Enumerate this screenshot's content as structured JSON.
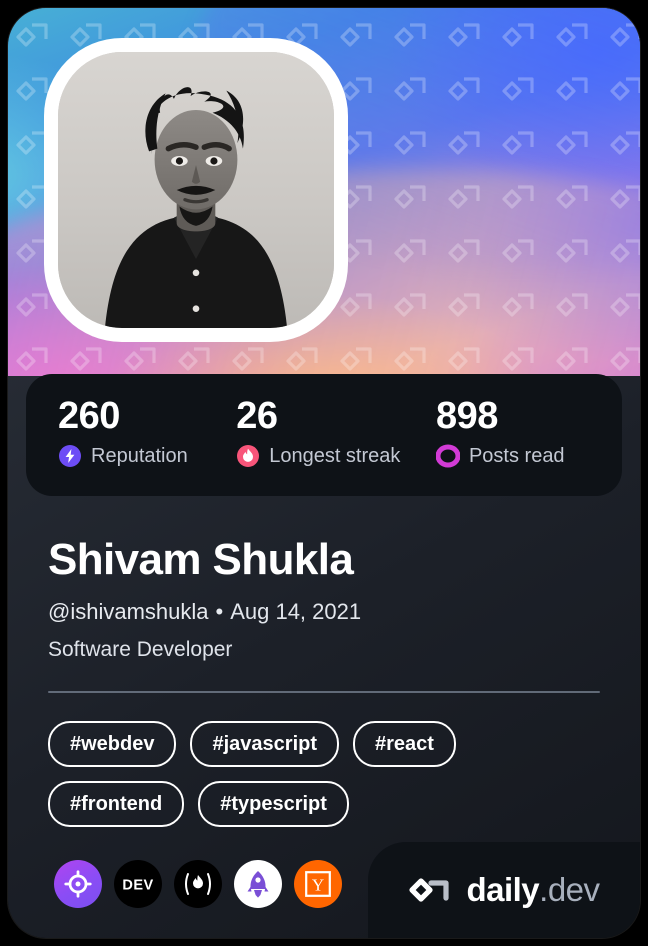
{
  "card": {
    "type": "devcard",
    "theme_accent": "#8a4df5",
    "card_bg": "#262b34",
    "stats_bar_bg": "#0e1217"
  },
  "avatar": {
    "icon": "user-photo",
    "alt": "Shivam Shukla profile photo",
    "border_color": "#ffffff"
  },
  "stats": [
    {
      "value": "260",
      "label": "Reputation",
      "icon": "bolt-icon",
      "color": "#6d4df6"
    },
    {
      "value": "26",
      "label": "Longest streak",
      "icon": "flame-icon",
      "color": "#f8557a"
    },
    {
      "value": "898",
      "label": "Posts read",
      "icon": "ring-icon",
      "color": "#d23bd6"
    }
  ],
  "profile": {
    "name": "Shivam Shukla",
    "handle": "@ishivamshukla",
    "separator": "•",
    "joined": "Aug 14, 2021",
    "role": "Software Developer"
  },
  "tags": [
    "#webdev",
    "#javascript",
    "#react",
    "#frontend",
    "#typescript"
  ],
  "socials": [
    {
      "name": "roadmap-icon",
      "label": "Roadmap.sh"
    },
    {
      "name": "dev-to-icon",
      "label": "DEV"
    },
    {
      "name": "hashnode-icon",
      "label": "Hashnode"
    },
    {
      "name": "producthunt-icon",
      "label": "Product Hunt"
    },
    {
      "name": "ycombinator-icon",
      "label": "Y Combinator"
    }
  ],
  "brand": {
    "logo_icon": "daily-dev-logo",
    "name": "daily",
    "suffix": ".dev"
  }
}
